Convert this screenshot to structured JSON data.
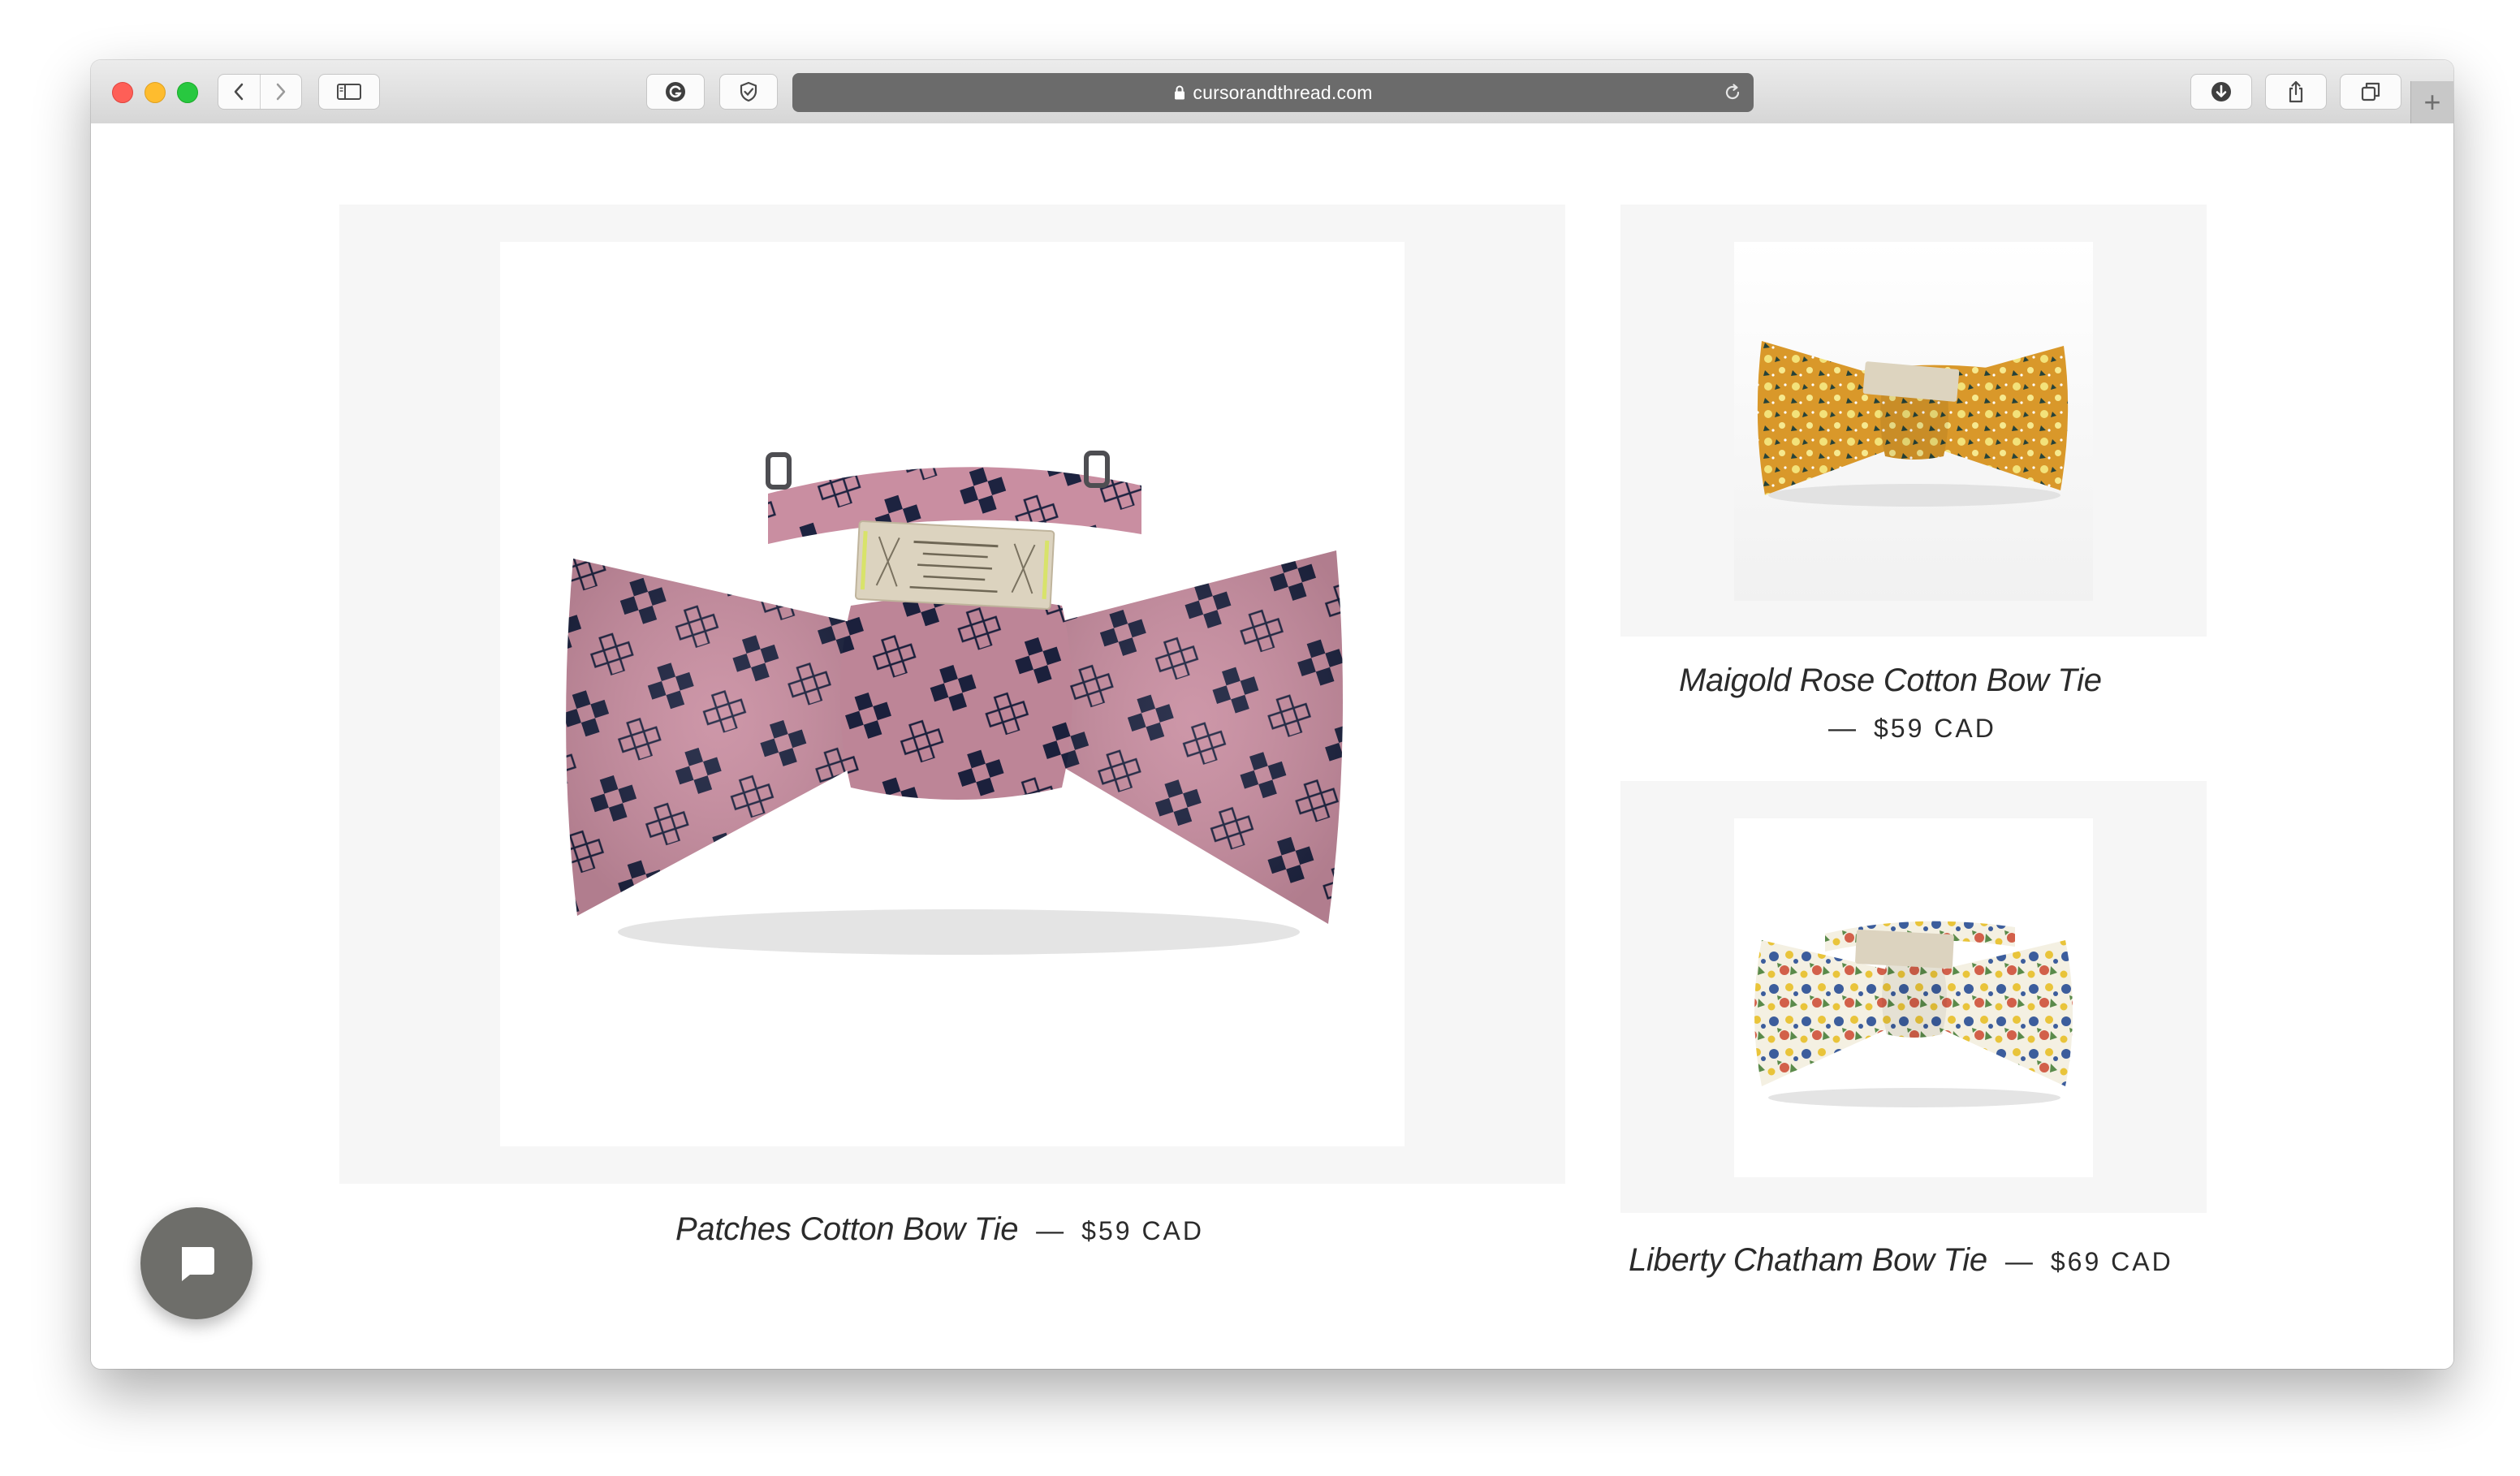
{
  "browser": {
    "url": "cursorandthread.com",
    "new_tab_label": "+"
  },
  "products": [
    {
      "title": "Patches Cotton Bow Tie",
      "dash": "—",
      "price": "$59 CAD"
    },
    {
      "title": "Maigold Rose Cotton Bow Tie",
      "dash": "—",
      "price": "$59 CAD"
    },
    {
      "title": "Liberty Chatham Bow Tie",
      "dash": "—",
      "price": "$69 CAD"
    }
  ],
  "icons": {
    "back": "chevron-left-icon",
    "forward": "chevron-right-icon",
    "sidebar": "sidebar-icon",
    "grammarly": "grammarly-icon",
    "shield": "shield-icon",
    "lock": "lock-icon",
    "reload": "reload-icon",
    "download": "download-icon",
    "share": "share-icon",
    "tabs": "tabs-icon",
    "chat": "chat-icon"
  },
  "colors": {
    "toolbar": "#d6d6d6",
    "address_bar": "#6b6b6b",
    "card_background": "#f6f6f6",
    "chat_button": "#6e6e6a",
    "bowtie_pink": "#c98ea1",
    "bowtie_navy": "#1d2340",
    "bowtie_mustard": "#d9982a"
  }
}
